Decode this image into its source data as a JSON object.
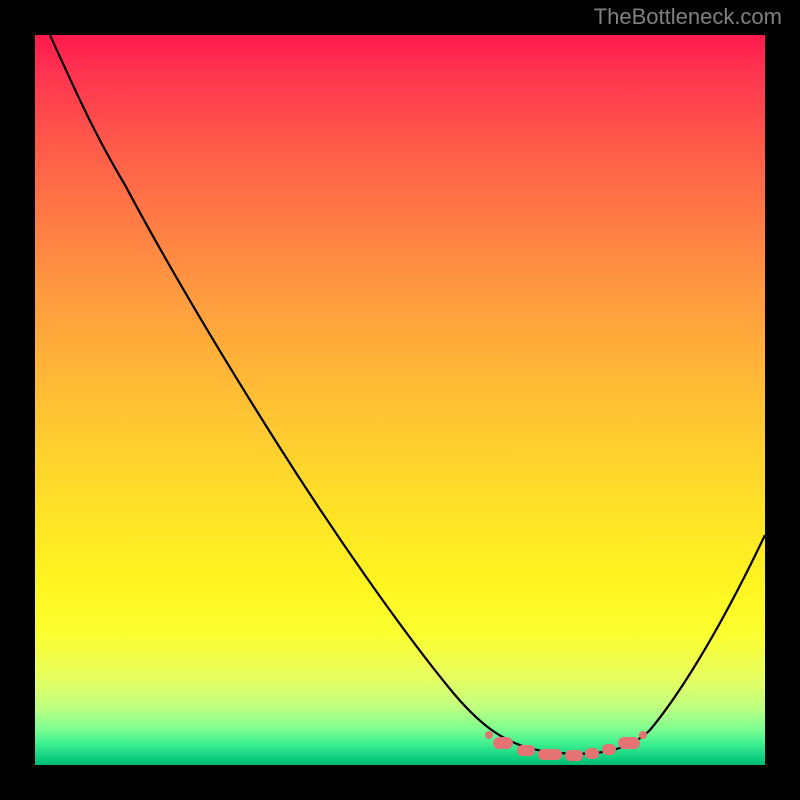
{
  "attribution": "TheBottleneck.com",
  "chart_data": {
    "type": "line",
    "title": "",
    "xlabel": "",
    "ylabel": "",
    "xlim": [
      0,
      100
    ],
    "ylim": [
      0,
      100
    ],
    "curve_points": [
      {
        "x": 2,
        "y": 100
      },
      {
        "x": 8,
        "y": 90
      },
      {
        "x": 15,
        "y": 78
      },
      {
        "x": 25,
        "y": 62
      },
      {
        "x": 35,
        "y": 46
      },
      {
        "x": 45,
        "y": 30
      },
      {
        "x": 55,
        "y": 14
      },
      {
        "x": 62,
        "y": 5
      },
      {
        "x": 66,
        "y": 2
      },
      {
        "x": 70,
        "y": 1
      },
      {
        "x": 74,
        "y": 1
      },
      {
        "x": 78,
        "y": 1
      },
      {
        "x": 82,
        "y": 2
      },
      {
        "x": 86,
        "y": 6
      },
      {
        "x": 92,
        "y": 16
      },
      {
        "x": 100,
        "y": 32
      }
    ],
    "highlight_region_x": [
      63,
      83
    ],
    "highlight_points": [
      {
        "x": 63,
        "y": 2.5
      },
      {
        "x": 66,
        "y": 1.5
      },
      {
        "x": 69,
        "y": 1
      },
      {
        "x": 72,
        "y": 0.8
      },
      {
        "x": 75,
        "y": 0.8
      },
      {
        "x": 78,
        "y": 1
      },
      {
        "x": 80,
        "y": 1.5
      },
      {
        "x": 83,
        "y": 2.8
      }
    ],
    "gradient_meaning": "red_high_to_green_low_bottleneck"
  }
}
